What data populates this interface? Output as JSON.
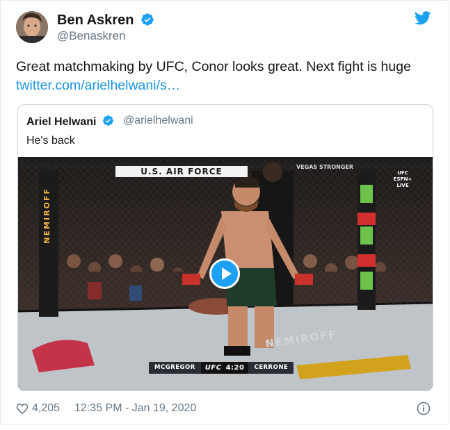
{
  "tweet": {
    "author_name": "Ben Askren",
    "author_handle": "@Benaskren",
    "text": "Great matchmaking by UFC, Conor looks great.  Next fight is huge",
    "link": "twitter.com/arielhelwani/s…",
    "likes": "4,205",
    "timestamp": "12:35 PM - Jan 19, 2020"
  },
  "quoted": {
    "author_name": "Ariel Helwani",
    "author_handle": "@arielhelwani",
    "text": "He's back"
  },
  "video": {
    "banner_left": "U.S. AIR FORCE",
    "banner_right": "VEGAS STRONGER",
    "broadcast_bug_line1": "UFC",
    "broadcast_bug_line2": "ESPN+",
    "broadcast_bug_line3": "LIVE",
    "side_brand": "NEMIROFF",
    "mat_brand": "NEMIROFF",
    "score_left": "MCGREGOR",
    "score_org": "UFC",
    "score_time": "4:20",
    "score_right": "CERRONE"
  },
  "colors": {
    "accent": "#1da1f2",
    "link": "#1b95e0",
    "secondary_text": "#657786",
    "border": "#ccd6dd"
  },
  "icons": [
    "verified-badge-icon",
    "twitter-bird-icon",
    "heart-icon",
    "info-icon",
    "play-icon"
  ]
}
